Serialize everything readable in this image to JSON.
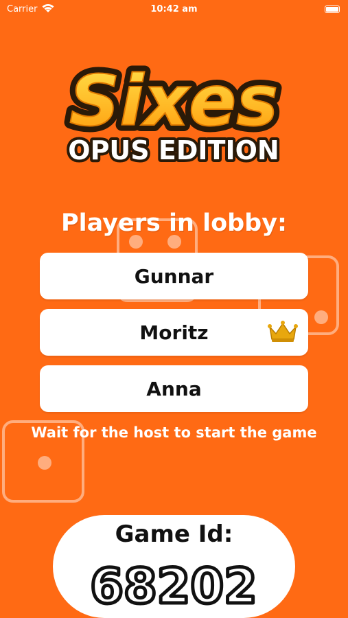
{
  "status_bar": {
    "carrier": "Carrier",
    "time": "10:42 am"
  },
  "logo": {
    "title": "Sixes",
    "edition": "OPUS EDITION",
    "title_color": "#FFB61A",
    "outline_color": "#2A1A08"
  },
  "lobby": {
    "heading": "Players in lobby:",
    "players": [
      {
        "name": "Gunnar",
        "is_host": false
      },
      {
        "name": "Moritz",
        "is_host": true
      },
      {
        "name": "Anna",
        "is_host": false
      }
    ],
    "host_icon": "crown-icon",
    "wait_message": "Wait for the host to start the game"
  },
  "game": {
    "id_label": "Game Id:",
    "id_value": "68202"
  },
  "colors": {
    "background": "#FF6A14",
    "card": "#FFFFFF",
    "crown": "#E8A70E"
  }
}
